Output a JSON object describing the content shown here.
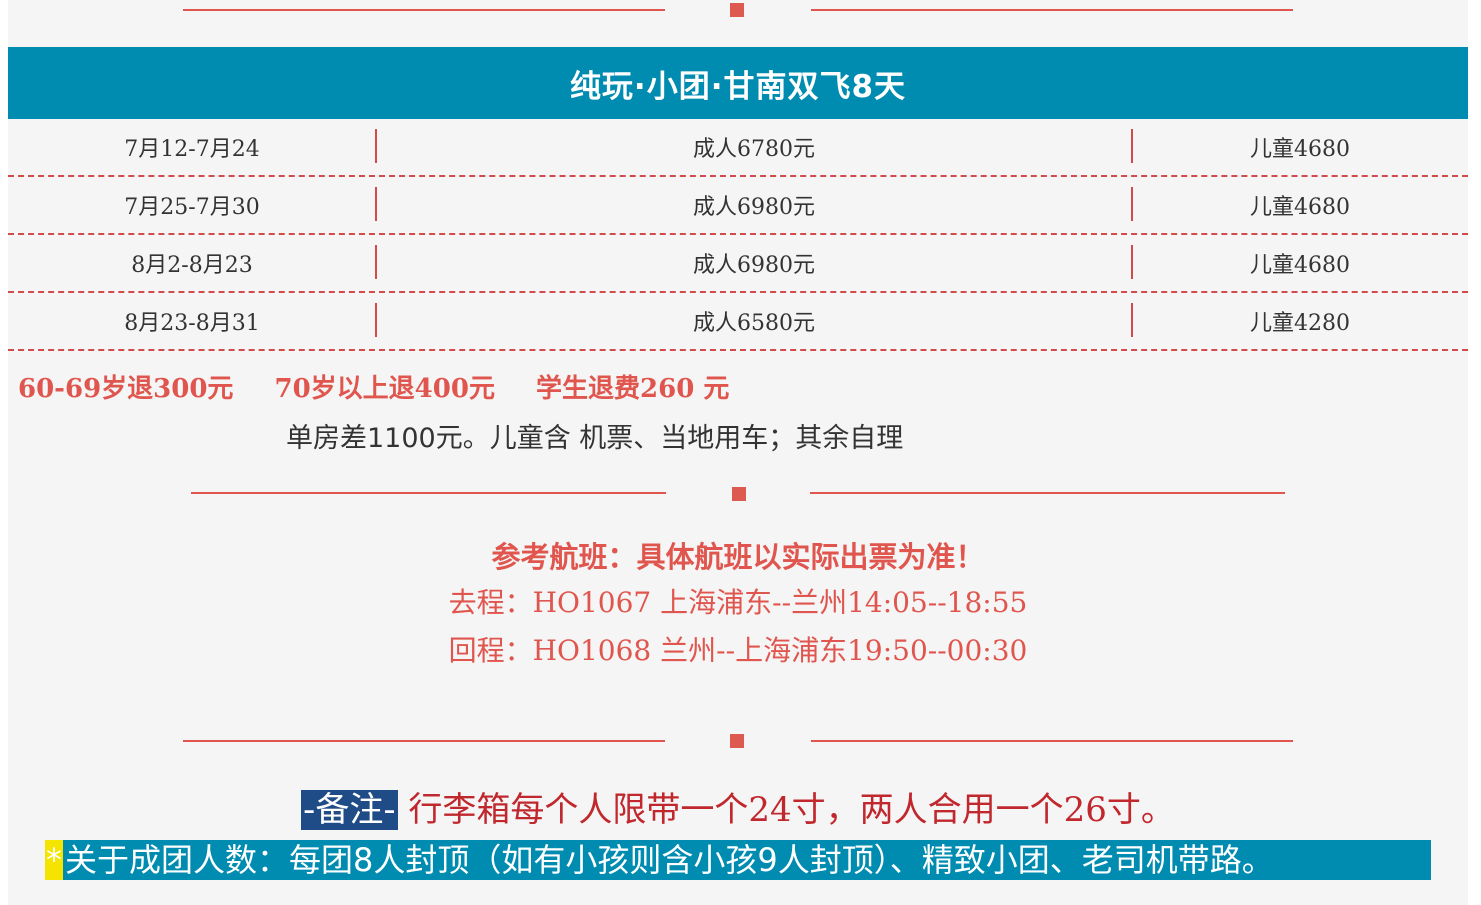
{
  "title": "纯玩·小团·甘南双飞8天",
  "price_rows": [
    {
      "dates": "7月12-7月24",
      "adult": "成人6780元",
      "child": "儿童4680"
    },
    {
      "dates": "7月25-7月30",
      "adult": "成人6980元",
      "child": "儿童4680"
    },
    {
      "dates": "8月2-8月23",
      "adult": "成人6980元",
      "child": "儿童4680"
    },
    {
      "dates": "8月23-8月31",
      "adult": "成人6580元",
      "child": "儿童4280"
    }
  ],
  "discounts": [
    "60-69岁退300元",
    "70岁以上退400元",
    "学生退费260 元"
  ],
  "note": "单房差1100元。儿童含 机票、当地用车；其余自理",
  "flights": {
    "title": "参考航班：具体航班以实际出票为准！",
    "outbound": "去程：HO1067 上海浦东--兰州14:05--18:55",
    "return": "回程：HO1068  兰州--上海浦东19:50--00:30"
  },
  "remark": {
    "tag": "-备注-",
    "text": " 行李箱每个人限带一个24寸，两人合用一个26寸。"
  },
  "group_note": {
    "marker": "*",
    "text": "关于成团人数：每团8人封顶（如有小孩则含小孩9人封顶）、精致小团、老司机带路。"
  },
  "colors": {
    "title_band": "#008bb0",
    "accent_red": "#e0564e",
    "remark_tag_bg": "#1f4b87",
    "marker_yellow": "#f5e400"
  }
}
